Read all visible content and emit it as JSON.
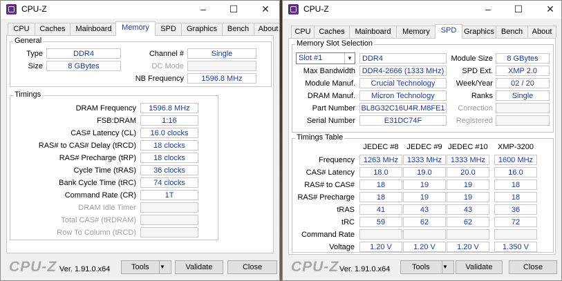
{
  "window1": {
    "title": "CPU-Z",
    "tabs": [
      "CPU",
      "Caches",
      "Mainboard",
      "Memory",
      "SPD",
      "Graphics",
      "Bench",
      "About"
    ],
    "active_tab": "Memory",
    "general": {
      "title": "General",
      "type_label": "Type",
      "type_value": "DDR4",
      "size_label": "Size",
      "size_value": "8 GBytes",
      "channel_label": "Channel #",
      "channel_value": "Single",
      "dc_mode_label": "DC Mode",
      "dc_mode_value": "",
      "nb_freq_label": "NB Frequency",
      "nb_freq_value": "1596.8 MHz"
    },
    "timings": {
      "title": "Timings",
      "rows": [
        {
          "label": "DRAM Frequency",
          "value": "1596.8 MHz",
          "disabled": false
        },
        {
          "label": "FSB:DRAM",
          "value": "1:16",
          "disabled": false
        },
        {
          "label": "CAS# Latency (CL)",
          "value": "16.0 clocks",
          "disabled": false
        },
        {
          "label": "RAS# to CAS# Delay (tRCD)",
          "value": "18 clocks",
          "disabled": false
        },
        {
          "label": "RAS# Precharge (tRP)",
          "value": "18 clocks",
          "disabled": false
        },
        {
          "label": "Cycle Time (tRAS)",
          "value": "36 clocks",
          "disabled": false
        },
        {
          "label": "Bank Cycle Time (tRC)",
          "value": "74 clocks",
          "disabled": false
        },
        {
          "label": "Command Rate (CR)",
          "value": "1T",
          "disabled": false
        },
        {
          "label": "DRAM Idle Timer",
          "value": "",
          "disabled": true
        },
        {
          "label": "Total CAS# (tRDRAM)",
          "value": "",
          "disabled": true
        },
        {
          "label": "Row To Column (tRCD)",
          "value": "",
          "disabled": true
        }
      ]
    },
    "footer": {
      "logo": "CPU-Z",
      "version": "Ver. 1.91.0.x64",
      "tools": "Tools",
      "validate": "Validate",
      "close": "Close"
    }
  },
  "window2": {
    "title": "CPU-Z",
    "tabs": [
      "CPU",
      "Caches",
      "Mainboard",
      "Memory",
      "SPD",
      "Graphics",
      "Bench",
      "About"
    ],
    "active_tab": "SPD",
    "slot": {
      "title": "Memory Slot Selection",
      "selected_slot": "Slot #1",
      "type_value": "DDR4",
      "module_size_label": "Module Size",
      "module_size_value": "8 GBytes",
      "max_bw_label": "Max Bandwidth",
      "max_bw_value": "DDR4-2666 (1333 MHz)",
      "spd_ext_label": "SPD Ext.",
      "spd_ext_value": "XMP 2.0",
      "module_manuf_label": "Module Manuf.",
      "module_manuf_value": "Crucial Technology",
      "week_year_label": "Week/Year",
      "week_year_value": "02 / 20",
      "dram_manuf_label": "DRAM Manuf.",
      "dram_manuf_value": "Micron Technology",
      "ranks_label": "Ranks",
      "ranks_value": "Single",
      "part_label": "Part Number",
      "part_value": "BL8G32C16U4R.M8FE1",
      "correction_label": "Correction",
      "correction_value": "",
      "serial_label": "Serial Number",
      "serial_value": "E31DC74F",
      "registered_label": "Registered",
      "registered_value": ""
    },
    "timings_table": {
      "title": "Timings Table",
      "columns": [
        "JEDEC #8",
        "JEDEC #9",
        "JEDEC #10",
        "XMP-3200"
      ],
      "rows": [
        {
          "label": "Frequency",
          "values": [
            "1263 MHz",
            "1333 MHz",
            "1333 MHz",
            "1600 MHz"
          ]
        },
        {
          "label": "CAS# Latency",
          "values": [
            "18.0",
            "19.0",
            "20.0",
            "16.0"
          ]
        },
        {
          "label": "RAS# to CAS#",
          "values": [
            "18",
            "19",
            "19",
            "18"
          ]
        },
        {
          "label": "RAS# Precharge",
          "values": [
            "18",
            "19",
            "19",
            "18"
          ]
        },
        {
          "label": "tRAS",
          "values": [
            "41",
            "43",
            "43",
            "36"
          ]
        },
        {
          "label": "tRC",
          "values": [
            "59",
            "62",
            "62",
            "72"
          ]
        },
        {
          "label": "Command Rate",
          "values": [
            "",
            "",
            "",
            ""
          ]
        },
        {
          "label": "Voltage",
          "values": [
            "1.20 V",
            "1.20 V",
            "1.20 V",
            "1.350 V"
          ]
        }
      ]
    },
    "footer": {
      "logo": "CPU-Z",
      "version": "Ver. 1.91.0.x64",
      "tools": "Tools",
      "validate": "Validate",
      "close": "Close"
    }
  },
  "colors": {
    "value_text": "#1c3aa9",
    "app_icon": "#5b2c8a"
  },
  "icons": {
    "minimize": "minimize-icon",
    "maximize": "maximize-icon",
    "close": "close-icon"
  }
}
